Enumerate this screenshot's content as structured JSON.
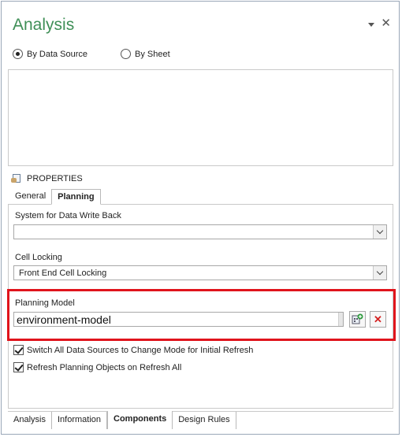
{
  "pane": {
    "title": "Analysis",
    "menu_icon": "dropdown-arrow-icon",
    "close_icon": "close-icon"
  },
  "view_mode": {
    "options": [
      {
        "label": "By Data Source",
        "checked": true
      },
      {
        "label": "By Sheet",
        "checked": false
      }
    ]
  },
  "properties": {
    "heading": "PROPERTIES",
    "icon": "properties-icon",
    "tabs": [
      {
        "label": "General",
        "active": false
      },
      {
        "label": "Planning",
        "active": true
      }
    ],
    "system_write_back": {
      "label": "System for Data Write Back",
      "value": ""
    },
    "cell_locking": {
      "label": "Cell Locking",
      "value": "Front End Cell Locking"
    },
    "planning_model": {
      "label": "Planning Model",
      "value": "environment-model",
      "select_icon": "select-model-icon",
      "clear_icon": "clear-red-x-icon"
    },
    "options": [
      {
        "label": "Switch All Data Sources to Change Mode for Initial Refresh",
        "checked": true
      },
      {
        "label": "Refresh Planning Objects on Refresh All",
        "checked": true
      }
    ]
  },
  "bottom_tabs": [
    {
      "label": "Analysis",
      "active": false
    },
    {
      "label": "Information",
      "active": false
    },
    {
      "label": "Components",
      "active": true
    },
    {
      "label": "Design Rules",
      "active": false
    }
  ],
  "colors": {
    "title": "#3f8f57",
    "highlight": "#e0141c",
    "clear_x": "#d42020"
  }
}
